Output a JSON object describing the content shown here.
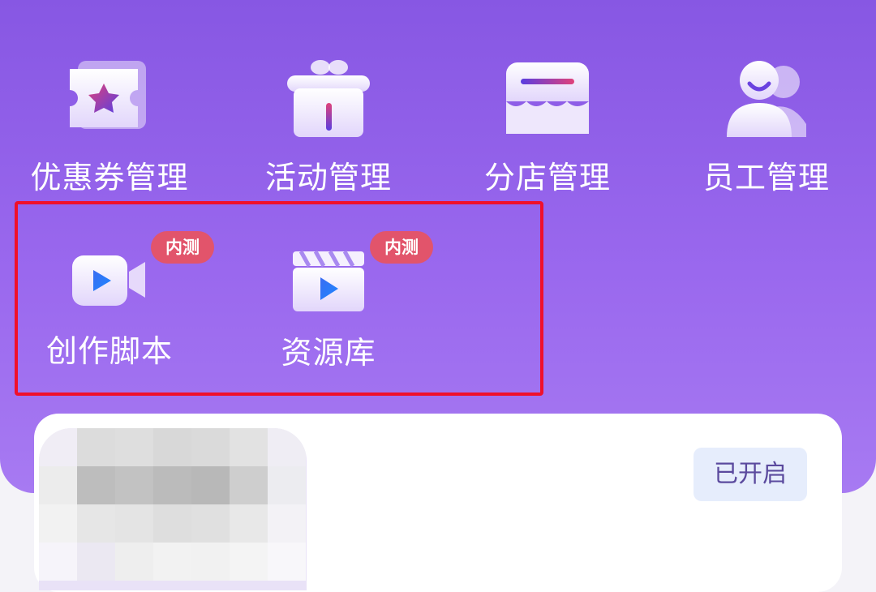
{
  "menu": {
    "row1": [
      {
        "label": "优惠券管理",
        "icon": "coupon-icon"
      },
      {
        "label": "活动管理",
        "icon": "gift-icon"
      },
      {
        "label": "分店管理",
        "icon": "store-icon"
      },
      {
        "label": "员工管理",
        "icon": "staff-icon"
      }
    ],
    "row2": [
      {
        "label": "创作脚本",
        "icon": "video-camera-icon",
        "badge": "内测"
      },
      {
        "label": "资源库",
        "icon": "clapperboard-icon",
        "badge": "内测"
      }
    ]
  },
  "card": {
    "status_label": "已开启"
  },
  "colors": {
    "header_purple": "#8757e3",
    "badge_red": "#e2546b",
    "highlight_red": "#f0102a",
    "status_bg": "#e6edfc"
  }
}
